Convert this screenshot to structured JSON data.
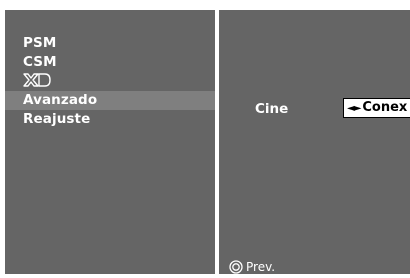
{
  "menu": {
    "items": [
      {
        "label": "PSM"
      },
      {
        "label": "CSM"
      },
      {
        "label": "XD"
      },
      {
        "label": "Avanzado"
      },
      {
        "label": "Reajuste"
      }
    ]
  },
  "submenu": {
    "option_label": "Cine",
    "option_value": "Conex",
    "option_arrows": "◄►"
  },
  "footer": {
    "prev_label": "Prev."
  },
  "colors": {
    "panel": "#656565",
    "selected_row": "#7f7f7f",
    "text": "#ffffff"
  },
  "icons": {
    "ok": "ok-circle-icon",
    "xd": "xd-logo-icon"
  }
}
